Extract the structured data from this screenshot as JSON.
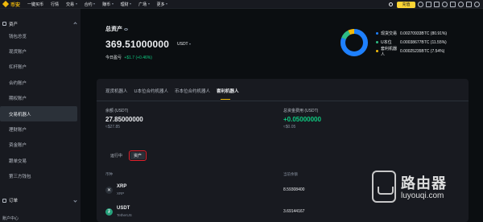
{
  "brand": {
    "name": "币安"
  },
  "nav": {
    "items": [
      "一键买币",
      "行情",
      "交易",
      "合约",
      "赚币",
      "理财",
      "广场",
      "更多"
    ],
    "deposit_label": "充值"
  },
  "sidebar": {
    "group_label": "资产",
    "items": [
      {
        "label": "钱包总览",
        "active": false
      },
      {
        "label": "现货账户",
        "active": false
      },
      {
        "label": "杠杆账户",
        "active": false
      },
      {
        "label": "合约账户",
        "active": false
      },
      {
        "label": "期权账户",
        "active": false
      },
      {
        "label": "交易机器人",
        "active": true
      },
      {
        "label": "理财账户",
        "active": false
      },
      {
        "label": "资金账户",
        "active": false
      },
      {
        "label": "跟单交易",
        "active": false
      },
      {
        "label": "第三方钱包",
        "active": false
      }
    ],
    "order_label": "订单",
    "bottom_label": "账户中心"
  },
  "overview": {
    "title": "总资产",
    "amount": "369.51000000",
    "currency": "USDT",
    "pnl_label": "今日盈亏",
    "pnl_value": "+$1.7 (+0.46%)",
    "breakdown": [
      {
        "name": "现货交易",
        "value": "0.00270933BTC (80.91%)",
        "color": "#1e80ff",
        "percent": 80.91
      },
      {
        "name": "U本位",
        "value": "0.00038677BTC (11.55%)",
        "color": "#2ebd85",
        "percent": 11.55
      },
      {
        "name": "套利机器人",
        "value": "0.00025235BTC (7.54%)",
        "color": "#f0b90b",
        "percent": 7.54
      }
    ]
  },
  "tabs": [
    "现货机器人",
    "U本位合约机器人",
    "币本位合约机器人",
    "套利机器人"
  ],
  "stats": {
    "balance_label": "余额 (USDT)",
    "balance_value": "27.85000000",
    "balance_sub": "≈$27.85",
    "funding_label": "总资金费用 (USDT)",
    "funding_value": "+0.05000000",
    "funding_sub": "≈$0.05"
  },
  "subtabs": [
    "运行中",
    "资产"
  ],
  "table": {
    "headers": [
      "币种",
      "当前余额"
    ],
    "rows": [
      {
        "symbol": "XRP",
        "name": "XRP",
        "amount": "8.59308400",
        "icon": "x-icon"
      },
      {
        "symbol": "USDT",
        "name": "TetherUS",
        "amount": "3.69144167",
        "icon": "tether-icon"
      }
    ]
  },
  "watermark": {
    "cn": "路由器",
    "en": "luyouqi.com"
  }
}
